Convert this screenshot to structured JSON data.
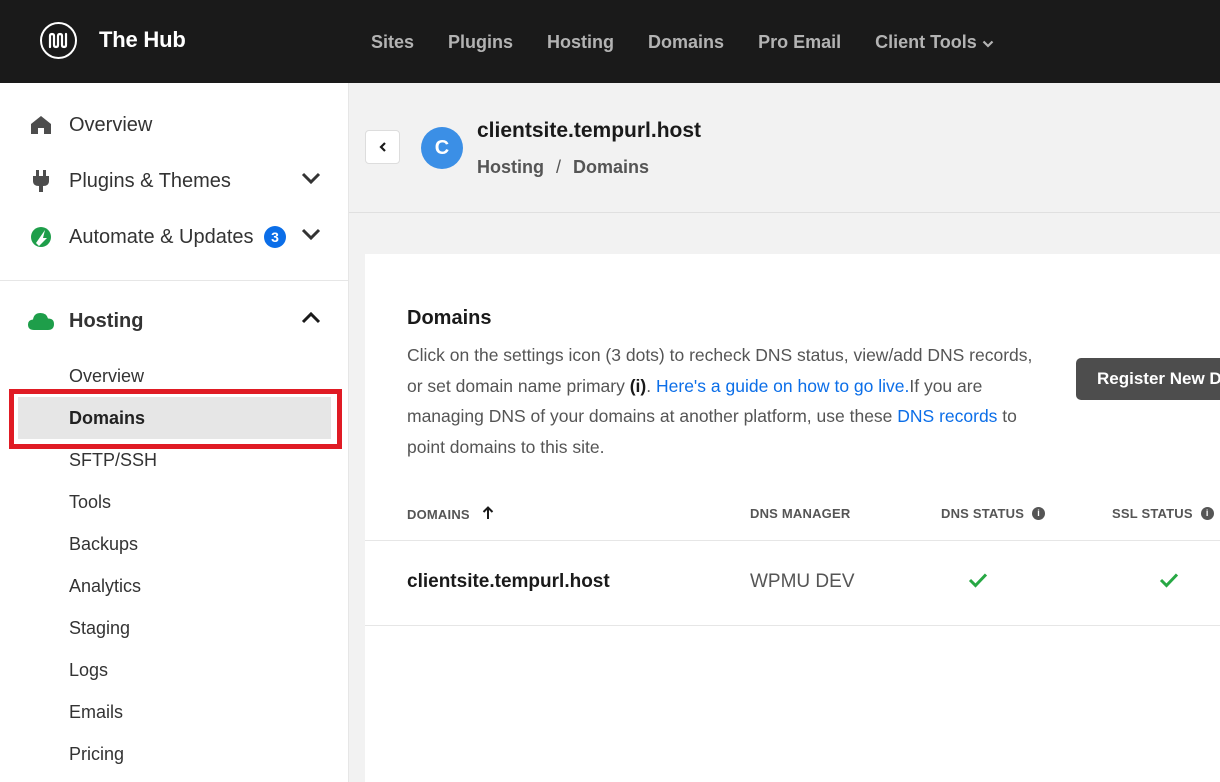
{
  "app": {
    "brand": "The Hub",
    "colors": {
      "topbar": "#1a1a1a",
      "accent": "#0b6ee8",
      "success": "#27a844",
      "highlight": "#e01b24"
    }
  },
  "nav": [
    {
      "label": "Sites"
    },
    {
      "label": "Plugins"
    },
    {
      "label": "Hosting"
    },
    {
      "label": "Domains"
    },
    {
      "label": "Pro Email"
    },
    {
      "label": "Client Tools",
      "icon": "chevron-down-icon"
    }
  ],
  "sidebar": {
    "top_items": [
      {
        "label": "Overview",
        "icon": "home-icon"
      },
      {
        "label": "Plugins & Themes",
        "icon": "plug-icon"
      },
      {
        "label": "Automate & Updates",
        "icon": "automate-icon",
        "badge": "3"
      }
    ],
    "section": {
      "label": "Hosting",
      "icon": "cloud-icon"
    },
    "sub_items": [
      {
        "label": "Overview"
      },
      {
        "label": "Domains",
        "active": true
      },
      {
        "label": "SFTP/SSH"
      },
      {
        "label": "Tools"
      },
      {
        "label": "Backups"
      },
      {
        "label": "Analytics"
      },
      {
        "label": "Staging"
      },
      {
        "label": "Logs"
      },
      {
        "label": "Emails"
      },
      {
        "label": "Pricing"
      }
    ]
  },
  "header": {
    "avatar_letter": "C",
    "site_title": "clientsite.tempurl.host",
    "breadcrumb": [
      "Hosting",
      "Domains"
    ],
    "breadcrumb_sep": "/"
  },
  "domains_card": {
    "title": "Domains",
    "desc_part1": "Click on the settings icon (3 dots) to recheck DNS status, view/add DNS records, or set domain name primary ",
    "desc_bold": "(i)",
    "desc_part2": ". ",
    "desc_link1": "Here's a guide on how to go live.",
    "desc_part3": "If you are managing DNS of your domains at another platform, use these ",
    "desc_link2": "DNS records",
    "desc_part4": " to point domains to this site.",
    "register_button": "Register New Domain",
    "columns": [
      "DOMAINS",
      "DNS MANAGER",
      "DNS STATUS",
      "SSL STATUS"
    ],
    "rows": [
      {
        "domain": "clientsite.tempurl.host",
        "dns_manager": "WPMU DEV",
        "dns_status": "ok",
        "ssl_status": "ok"
      }
    ]
  }
}
